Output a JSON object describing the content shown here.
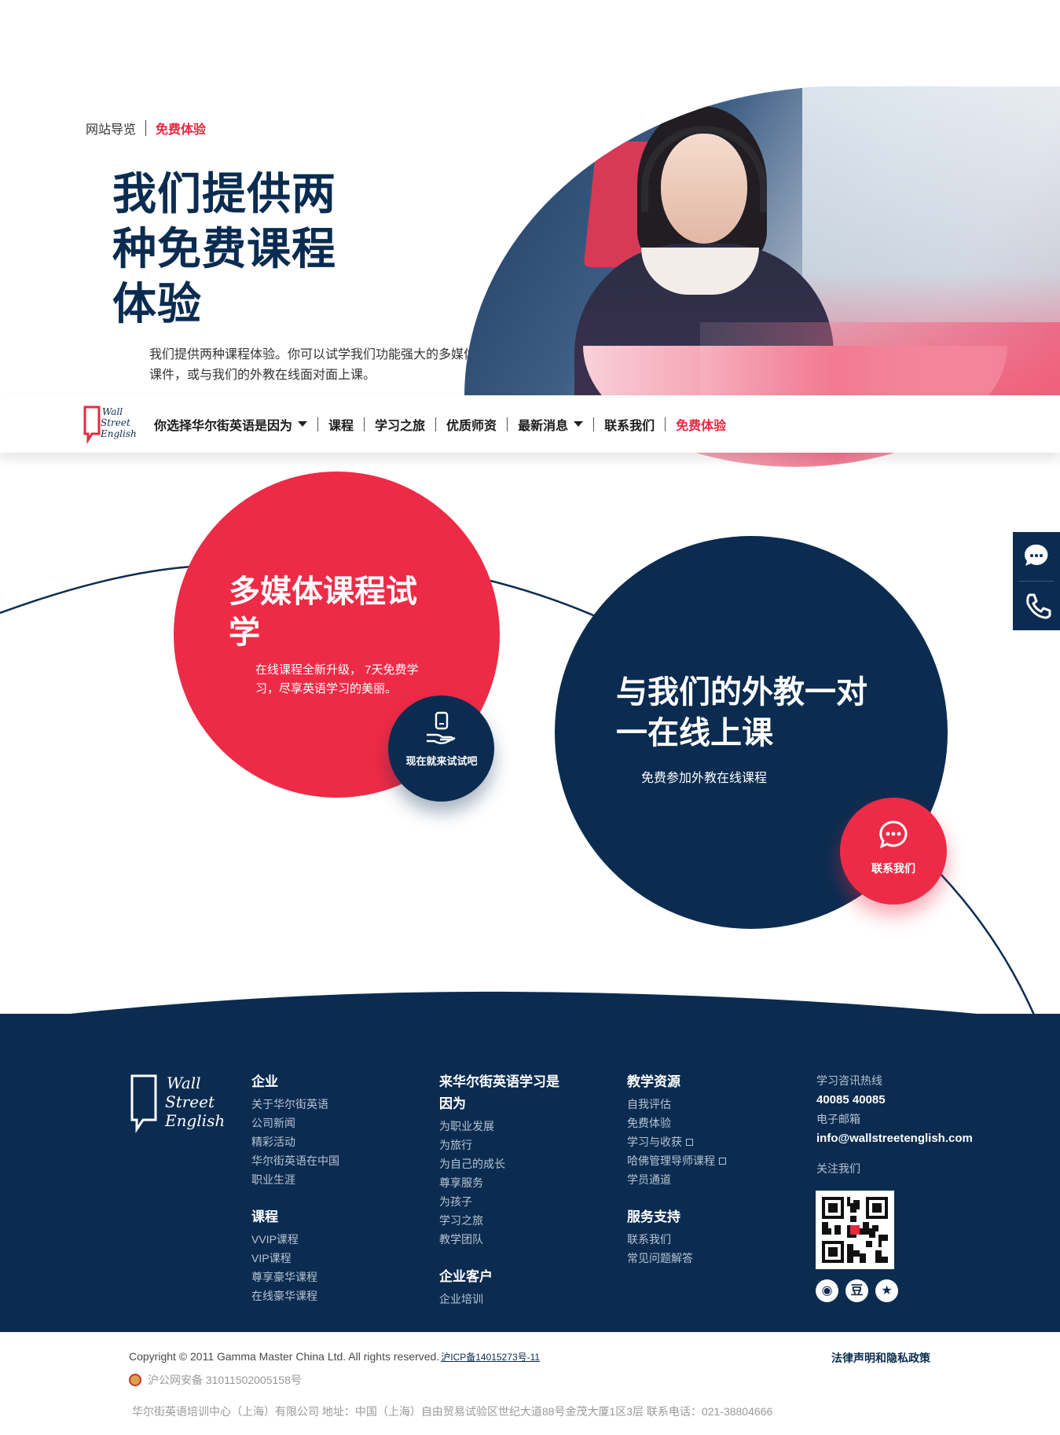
{
  "breadcrumb": {
    "home": "网站导览",
    "current": "免费体验"
  },
  "hero": {
    "title": "我们提供两种免费课程体验",
    "description": "我们提供两种课程体验。你可以试学我们功能强大的多媒体课件，或与我们的外教在线面对面上课。"
  },
  "nav": {
    "items": [
      "你选择华尔街英语是因为",
      "课程",
      "学习之旅",
      "优质师资",
      "最新消息",
      "联系我们",
      "免费体验"
    ]
  },
  "trial": {
    "title": "多媒体课程试学",
    "description": "在线课程全新升级， 7天免费学习，尽享英语学习的美丽。",
    "button": "现在就来试试吧"
  },
  "tutor": {
    "title": "与我们的外教一对一在线上课",
    "description": "免费参加外教在线课程",
    "button": "联系我们"
  },
  "footer": {
    "col1": {
      "title": "企业",
      "items": [
        "关于华尔街英语",
        "公司新闻",
        "精彩活动",
        "华尔街英语在中国",
        "职业生涯"
      ],
      "title2": "课程",
      "items2": [
        "VVIP课程",
        "VIP课程",
        "尊享豪华课程",
        "在线豪华课程"
      ]
    },
    "col2": {
      "title": "来华尔街英语学习是因为",
      "items": [
        "为职业发展",
        "为旅行",
        "为自己的成长",
        "尊享服务",
        "为孩子",
        "学习之旅",
        "教学团队"
      ],
      "title2": "企业客户",
      "items2": [
        "企业培训"
      ]
    },
    "col3": {
      "title": "教学资源",
      "items": [
        "自我评估",
        "免费体验",
        "学习与收获",
        "哈佛管理导师课程",
        "学员通道"
      ],
      "title2": "服务支持",
      "items2": [
        "联系我们",
        "常见问题解答"
      ]
    },
    "contact": {
      "hotline_label": "学习咨讯热线",
      "hotline": "40085 40085",
      "email_label": "电子邮箱",
      "email": "info@wallstreetenglish.com",
      "follow": "关注我们"
    }
  },
  "bottom": {
    "copyright": "Copyright © 2011 Gamma Master China Ltd. All rights reserved.",
    "icp": "沪ICP备14015273号-11",
    "gongan": "沪公网安备 31011502005158号",
    "address": "华尔街英语培训中心（上海）有限公司 地址：中国（上海）自由贸易试验区世纪大道88号金茂大厦1区3层 联系电话：021-38804666",
    "legal": "法律声明和隐私政策"
  },
  "colors": {
    "navy": "#0b2c50",
    "red": "#ee2b46"
  }
}
